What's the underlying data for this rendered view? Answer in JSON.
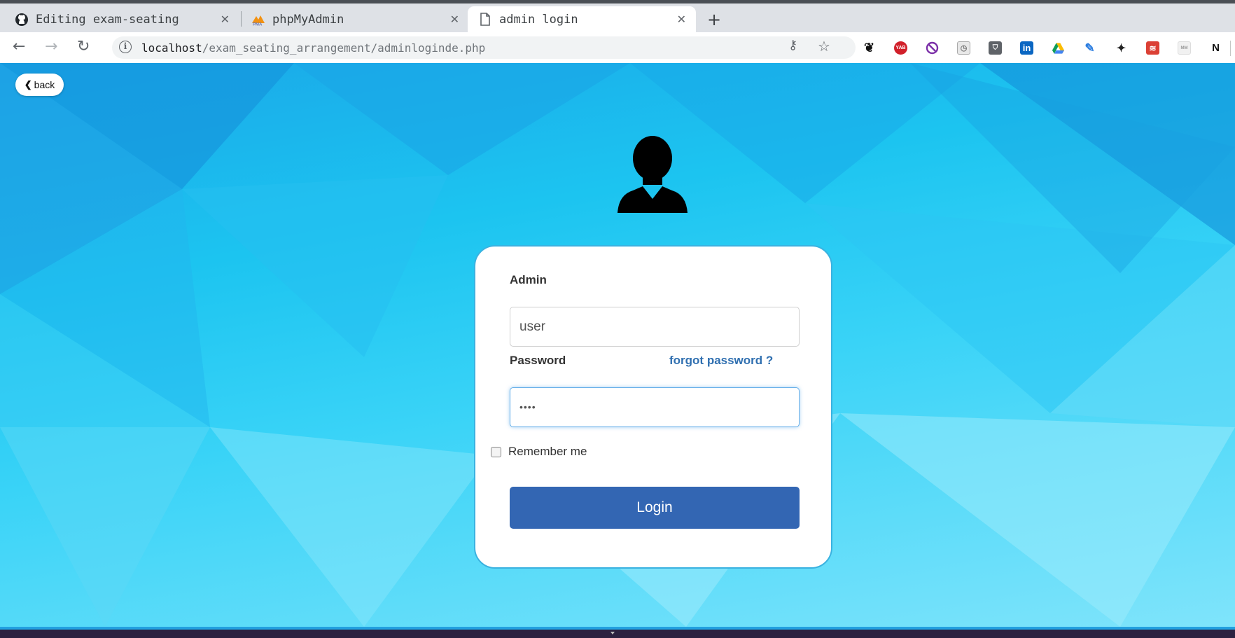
{
  "browser": {
    "tabs": [
      {
        "title": "Editing exam-seating",
        "icon": "github-icon"
      },
      {
        "title": "phpMyAdmin",
        "icon": "phpmyadmin-icon"
      },
      {
        "title": "admin login",
        "icon": "document-icon",
        "active": true
      }
    ],
    "url_host": "localhost",
    "url_path": "/exam_seating_arrangement/adminloginde.php",
    "extensions": [
      "gnome-icon",
      "yab-icon",
      "block-icon",
      "timer-icon",
      "shield-icon",
      "linkedin-icon",
      "drive-icon",
      "pen-icon",
      "kangaroo-icon",
      "todoist-icon",
      "mm-icon",
      "notion-icon"
    ]
  },
  "page": {
    "back_label": "back",
    "form": {
      "admin_label": "Admin",
      "admin_value": "user",
      "password_label": "Password",
      "forgot_label": "forgot password ?",
      "password_value": "••••",
      "remember_label": "Remember me",
      "login_label": "Login"
    }
  },
  "colors": {
    "accent": "#3366b3",
    "link": "#2f6fb0",
    "background": "#1cc4f0"
  }
}
